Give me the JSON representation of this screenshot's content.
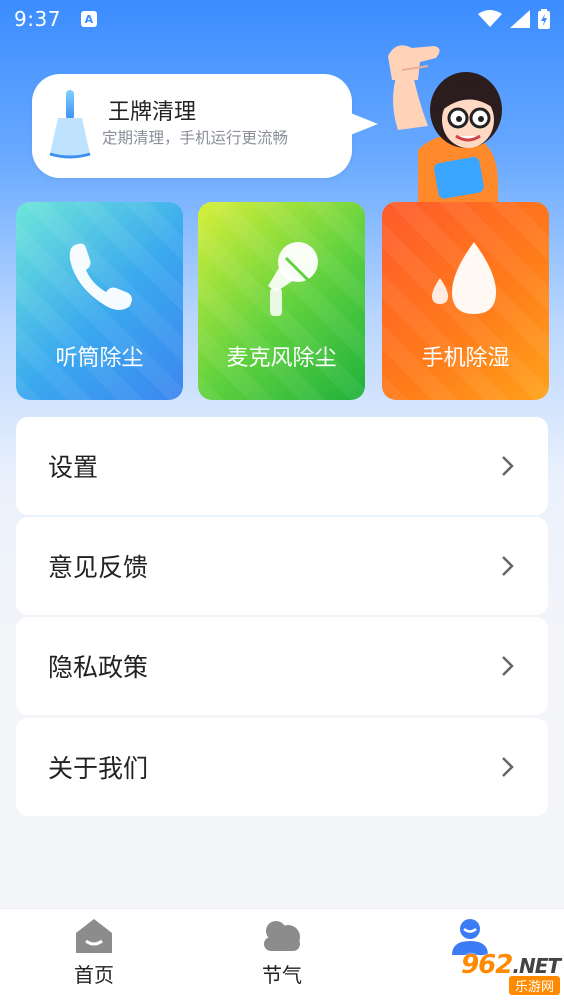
{
  "status_bar": {
    "time": "9:37",
    "notification": "A"
  },
  "banner": {
    "title": "王牌清理",
    "subtitle": "定期清理，手机运行更流畅"
  },
  "features": [
    {
      "label": "听筒除尘",
      "icon": "phone-receiver-icon"
    },
    {
      "label": "麦克风除尘",
      "icon": "microphone-icon"
    },
    {
      "label": "手机除湿",
      "icon": "water-drop-icon"
    }
  ],
  "menu": [
    {
      "label": "设置"
    },
    {
      "label": "意见反馈"
    },
    {
      "label": "隐私政策"
    },
    {
      "label": "关于我们"
    }
  ],
  "bottom_nav": [
    {
      "label": "首页",
      "icon": "home-icon"
    },
    {
      "label": "节气",
      "icon": "cloud-icon"
    },
    {
      "label": "",
      "icon": "user-icon"
    }
  ],
  "watermark": {
    "top": "962",
    "suffix": ".NET",
    "bottom": "乐游网"
  },
  "colors": {
    "accent": "#3b8cff",
    "card_blue": "#3aa8ef",
    "card_green": "#4fcc3c",
    "card_orange": "#ff7a1a"
  }
}
